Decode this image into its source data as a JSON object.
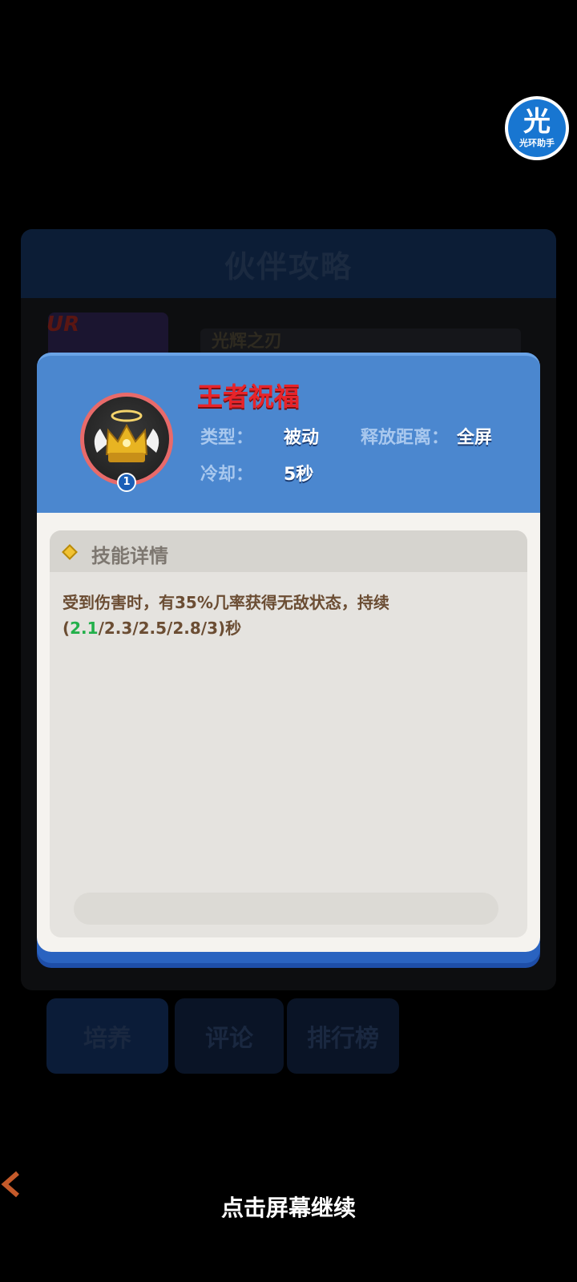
{
  "background": {
    "title": "伙伴攻略",
    "rarity": "UR",
    "partner_name": "光辉之刃",
    "tabs": [
      "培养",
      "评论",
      "排行榜"
    ]
  },
  "helper": {
    "glyph": "光",
    "label": "光环助手"
  },
  "skill": {
    "name": "王者祝福",
    "level": "1",
    "type_label": "类型：",
    "type_value": "被动",
    "range_label": "释放距离：",
    "range_value": "全屏",
    "cooldown_label": "冷却：",
    "cooldown_value": "5秒"
  },
  "details": {
    "title": "技能详情",
    "text_before": "受到伤害时，有35%几率获得无敌状态，持续(",
    "text_highlight": "2.1",
    "text_after": "/2.3/2.5/2.8/3)秒",
    "highlight_color": "#22b04a"
  },
  "continue_hint": "点击屏幕继续"
}
